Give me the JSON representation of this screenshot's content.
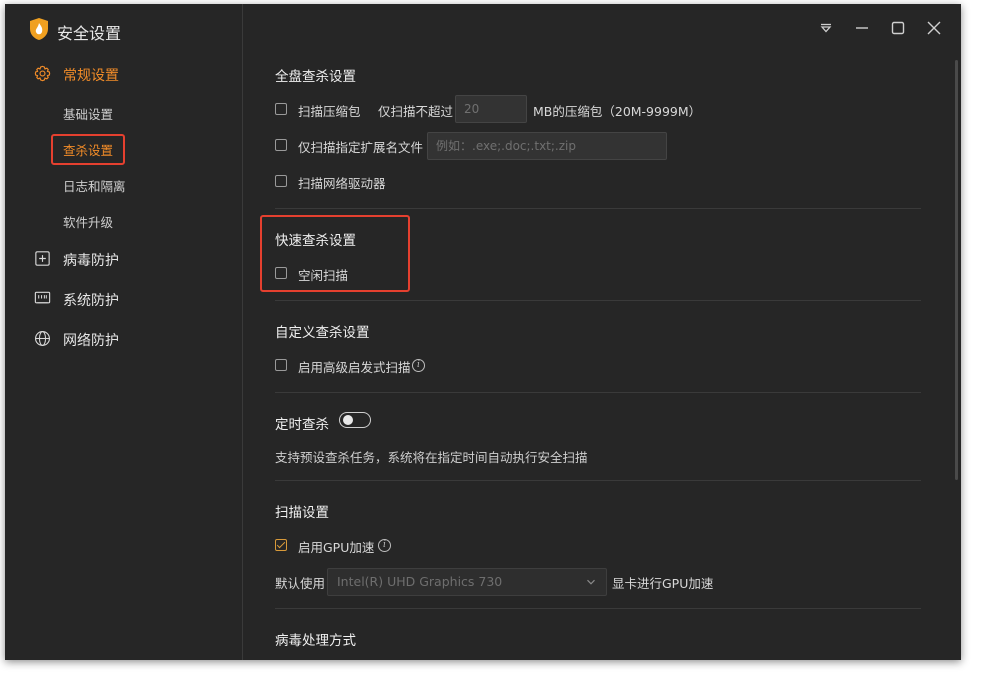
{
  "app": {
    "title": "安全设置",
    "accent_color": "#f28c28",
    "highlight_color": "#e5402f"
  },
  "titlebar": {
    "icons": [
      "menu-icon",
      "minimize-icon",
      "maximize-icon",
      "close-icon"
    ]
  },
  "sidebar": {
    "groups": [
      {
        "label": "常规设置",
        "icon": "gear-icon",
        "active": true,
        "items": [
          {
            "label": "基础设置"
          },
          {
            "label": "查杀设置",
            "active": true
          },
          {
            "label": "日志和隔离"
          },
          {
            "label": "软件升级"
          }
        ]
      },
      {
        "label": "病毒防护",
        "icon": "plus-box-icon"
      },
      {
        "label": "系统防护",
        "icon": "monitor-icon"
      },
      {
        "label": "网络防护",
        "icon": "globe-icon"
      }
    ]
  },
  "full_scan": {
    "title": "全盘查杀设置",
    "scan_archives": {
      "label": "扫描压缩包",
      "checked": false
    },
    "size_prefix": "仅扫描不超过",
    "size_value": "20",
    "size_suffix": "MB的压缩包（20M-9999M）",
    "ext_only": {
      "label": "仅扫描指定扩展名文件",
      "checked": false
    },
    "ext_placeholder": "例如：.exe;.doc;.txt;.zip",
    "network_drives": {
      "label": "扫描网络驱动器",
      "checked": false
    }
  },
  "quick_scan": {
    "title": "快速查杀设置",
    "idle_scan": {
      "label": "空闲扫描",
      "checked": false
    }
  },
  "custom_scan": {
    "title": "自定义查杀设置",
    "heuristic": {
      "label": "启用高级启发式扫描",
      "checked": false
    }
  },
  "scheduled": {
    "title": "定时查杀",
    "enabled": false,
    "description": "支持预设查杀任务，系统将在指定时间自动执行安全扫描"
  },
  "scan_settings": {
    "title": "扫描设置",
    "gpu": {
      "label": "启用GPU加速",
      "checked": true
    },
    "default_use": "默认使用",
    "gpu_device": "Intel(R) UHD Graphics 730",
    "gpu_suffix": "显卡进行GPU加速"
  },
  "virus_handling": {
    "title": "病毒处理方式"
  }
}
